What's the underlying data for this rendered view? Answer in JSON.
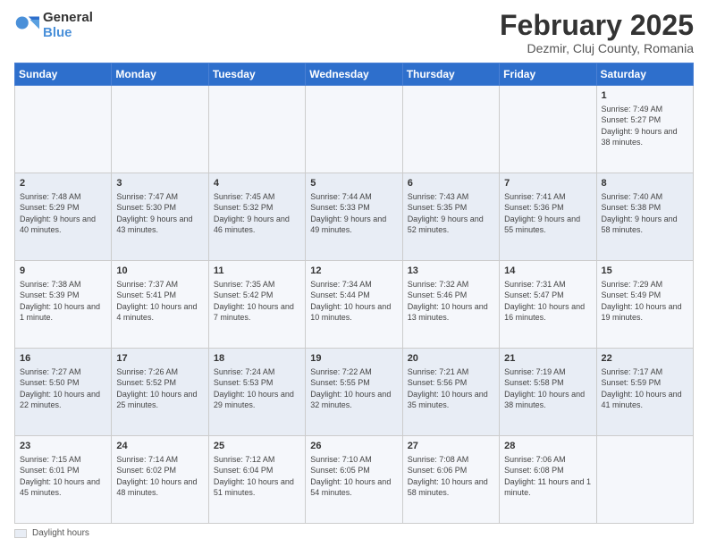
{
  "logo": {
    "general": "General",
    "blue": "Blue"
  },
  "header": {
    "month": "February 2025",
    "location": "Dezmir, Cluj County, Romania"
  },
  "days_of_week": [
    "Sunday",
    "Monday",
    "Tuesday",
    "Wednesday",
    "Thursday",
    "Friday",
    "Saturday"
  ],
  "weeks": [
    [
      {
        "num": "",
        "info": ""
      },
      {
        "num": "",
        "info": ""
      },
      {
        "num": "",
        "info": ""
      },
      {
        "num": "",
        "info": ""
      },
      {
        "num": "",
        "info": ""
      },
      {
        "num": "",
        "info": ""
      },
      {
        "num": "1",
        "info": "Sunrise: 7:49 AM\nSunset: 5:27 PM\nDaylight: 9 hours and 38 minutes."
      }
    ],
    [
      {
        "num": "2",
        "info": "Sunrise: 7:48 AM\nSunset: 5:29 PM\nDaylight: 9 hours and 40 minutes."
      },
      {
        "num": "3",
        "info": "Sunrise: 7:47 AM\nSunset: 5:30 PM\nDaylight: 9 hours and 43 minutes."
      },
      {
        "num": "4",
        "info": "Sunrise: 7:45 AM\nSunset: 5:32 PM\nDaylight: 9 hours and 46 minutes."
      },
      {
        "num": "5",
        "info": "Sunrise: 7:44 AM\nSunset: 5:33 PM\nDaylight: 9 hours and 49 minutes."
      },
      {
        "num": "6",
        "info": "Sunrise: 7:43 AM\nSunset: 5:35 PM\nDaylight: 9 hours and 52 minutes."
      },
      {
        "num": "7",
        "info": "Sunrise: 7:41 AM\nSunset: 5:36 PM\nDaylight: 9 hours and 55 minutes."
      },
      {
        "num": "8",
        "info": "Sunrise: 7:40 AM\nSunset: 5:38 PM\nDaylight: 9 hours and 58 minutes."
      }
    ],
    [
      {
        "num": "9",
        "info": "Sunrise: 7:38 AM\nSunset: 5:39 PM\nDaylight: 10 hours and 1 minute."
      },
      {
        "num": "10",
        "info": "Sunrise: 7:37 AM\nSunset: 5:41 PM\nDaylight: 10 hours and 4 minutes."
      },
      {
        "num": "11",
        "info": "Sunrise: 7:35 AM\nSunset: 5:42 PM\nDaylight: 10 hours and 7 minutes."
      },
      {
        "num": "12",
        "info": "Sunrise: 7:34 AM\nSunset: 5:44 PM\nDaylight: 10 hours and 10 minutes."
      },
      {
        "num": "13",
        "info": "Sunrise: 7:32 AM\nSunset: 5:46 PM\nDaylight: 10 hours and 13 minutes."
      },
      {
        "num": "14",
        "info": "Sunrise: 7:31 AM\nSunset: 5:47 PM\nDaylight: 10 hours and 16 minutes."
      },
      {
        "num": "15",
        "info": "Sunrise: 7:29 AM\nSunset: 5:49 PM\nDaylight: 10 hours and 19 minutes."
      }
    ],
    [
      {
        "num": "16",
        "info": "Sunrise: 7:27 AM\nSunset: 5:50 PM\nDaylight: 10 hours and 22 minutes."
      },
      {
        "num": "17",
        "info": "Sunrise: 7:26 AM\nSunset: 5:52 PM\nDaylight: 10 hours and 25 minutes."
      },
      {
        "num": "18",
        "info": "Sunrise: 7:24 AM\nSunset: 5:53 PM\nDaylight: 10 hours and 29 minutes."
      },
      {
        "num": "19",
        "info": "Sunrise: 7:22 AM\nSunset: 5:55 PM\nDaylight: 10 hours and 32 minutes."
      },
      {
        "num": "20",
        "info": "Sunrise: 7:21 AM\nSunset: 5:56 PM\nDaylight: 10 hours and 35 minutes."
      },
      {
        "num": "21",
        "info": "Sunrise: 7:19 AM\nSunset: 5:58 PM\nDaylight: 10 hours and 38 minutes."
      },
      {
        "num": "22",
        "info": "Sunrise: 7:17 AM\nSunset: 5:59 PM\nDaylight: 10 hours and 41 minutes."
      }
    ],
    [
      {
        "num": "23",
        "info": "Sunrise: 7:15 AM\nSunset: 6:01 PM\nDaylight: 10 hours and 45 minutes."
      },
      {
        "num": "24",
        "info": "Sunrise: 7:14 AM\nSunset: 6:02 PM\nDaylight: 10 hours and 48 minutes."
      },
      {
        "num": "25",
        "info": "Sunrise: 7:12 AM\nSunset: 6:04 PM\nDaylight: 10 hours and 51 minutes."
      },
      {
        "num": "26",
        "info": "Sunrise: 7:10 AM\nSunset: 6:05 PM\nDaylight: 10 hours and 54 minutes."
      },
      {
        "num": "27",
        "info": "Sunrise: 7:08 AM\nSunset: 6:06 PM\nDaylight: 10 hours and 58 minutes."
      },
      {
        "num": "28",
        "info": "Sunrise: 7:06 AM\nSunset: 6:08 PM\nDaylight: 11 hours and 1 minute."
      },
      {
        "num": "",
        "info": ""
      }
    ]
  ],
  "footer": {
    "label": "Daylight hours"
  }
}
